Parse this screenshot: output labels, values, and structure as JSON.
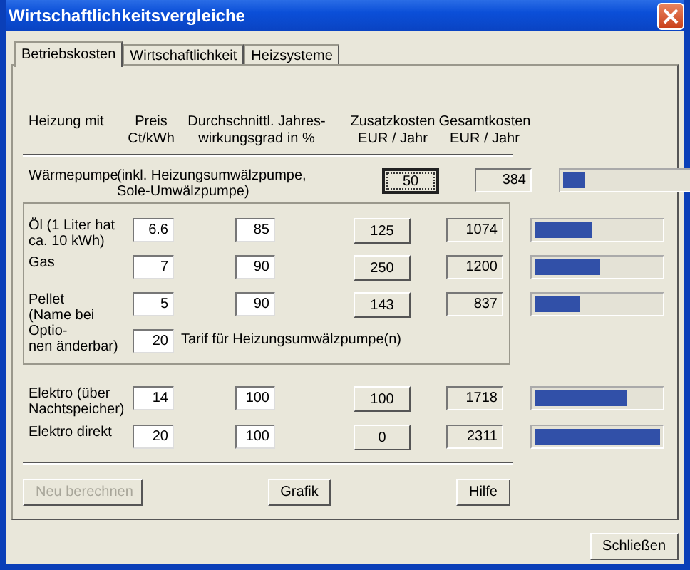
{
  "window": {
    "title": "Wirtschaftlichkeitsvergleiche"
  },
  "tabs": [
    {
      "label": "Betriebskosten",
      "selected": true
    },
    {
      "label": "Wirtschaftlichkeit",
      "selected": false
    },
    {
      "label": "Heizsysteme",
      "selected": false
    }
  ],
  "columns": [
    "Heizung mit",
    "Preis\nCt/kWh",
    "Durchschnittl. Jahres-\nwirkungsgrad in %",
    "Zusatzkosten\nEUR / Jahr",
    "Gesamtkosten\nEUR / Jahr"
  ],
  "heat_pump": {
    "name": "Wärmepumpe",
    "note": "(inkl. Heizungsumwälzpumpe,\nSole-Umwälzpumpe)",
    "extra_cost": "50",
    "focused": true,
    "total": "384",
    "level": 0.17
  },
  "group_rows": [
    {
      "name": "Öl (1 Liter hat\n ca. 10 kWh)",
      "price": "6.6",
      "efficiency": "85",
      "extra_cost": "125",
      "total": "1074",
      "level": 0.46
    },
    {
      "name": "Gas",
      "price": "7",
      "efficiency": "90",
      "extra_cost": "250",
      "total": "1200",
      "level": 0.52
    },
    {
      "name": "Pellet",
      "note": "(Name bei Optio-\n nen änderbar)",
      "price": "5",
      "efficiency": "90",
      "extra_cost": "143",
      "total": "837",
      "level": 0.36
    }
  ],
  "tariff": {
    "value": "20",
    "label": "Tarif für Heizungsumwälzpumpe(n)"
  },
  "electric_rows": [
    {
      "name": "Elektro (über\nNachtspeicher)",
      "price": "14",
      "efficiency": "100",
      "extra_cost": "100",
      "total": "1718",
      "level": 0.74
    },
    {
      "name": "Elektro direkt",
      "price": "20",
      "efficiency": "100",
      "extra_cost": "0",
      "total": "2311",
      "level": 1.0
    }
  ],
  "buttons": [
    {
      "label": "Neu berechnen",
      "disabled": true
    },
    {
      "label": "Grafik",
      "disabled": false
    },
    {
      "label": "Hilfe",
      "disabled": false
    }
  ],
  "close_button": "Schließen"
}
